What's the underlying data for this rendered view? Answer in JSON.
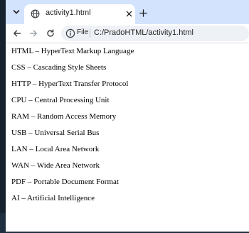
{
  "browser": {
    "tab_title": "activity1.html",
    "scheme_label": "File",
    "url": "C:/PradoHTML/activity1.html"
  },
  "icons": {
    "tab_menu": "chevron-down-icon",
    "tab_favicon": "globe-icon",
    "tab_close": "close-icon",
    "new_tab": "plus-icon",
    "back": "arrow-left-icon",
    "forward": "arrow-right-icon",
    "reload": "reload-icon",
    "site_info": "info-icon"
  },
  "colors": {
    "tabstrip": "#d3e3fd",
    "omnibox": "#eef1f6",
    "page_background": "#ffffff"
  },
  "page": {
    "items": [
      "HTML – HyperText Markup Language",
      "CSS – Cascading Style Sheets",
      "HTTP – HyperText Transfer Protocol",
      "CPU – Central Processing Unit",
      "RAM – Random Access Memory",
      "USB – Universal Serial Bus",
      "LAN – Local Area Network",
      "WAN – Wide Area Network",
      "PDF – Portable Document Format",
      "AI – Artificial Intelligence"
    ]
  }
}
